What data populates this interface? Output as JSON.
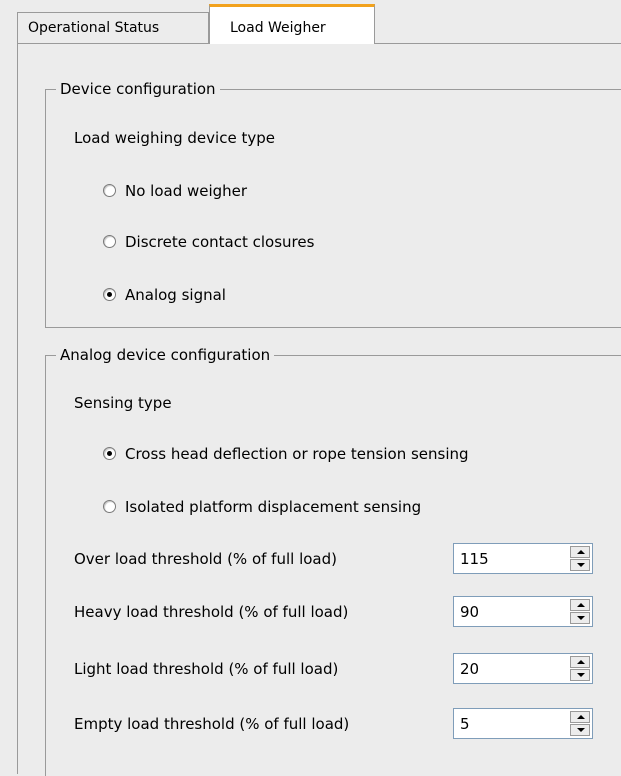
{
  "tabs": [
    {
      "label": "Operational Status",
      "active": false
    },
    {
      "label": "Load Weigher",
      "active": true
    }
  ],
  "colors": {
    "active_tab_accent": "#f2a21d",
    "background": "#ececec",
    "border": "#9a9a9a"
  },
  "device_configuration": {
    "legend": "Device configuration",
    "subheading": "Load weighing device type",
    "options": [
      {
        "label": "No load weigher",
        "selected": false
      },
      {
        "label": "Discrete contact closures",
        "selected": false
      },
      {
        "label": "Analog signal",
        "selected": true
      }
    ]
  },
  "analog_configuration": {
    "legend": "Analog device configuration",
    "subheading": "Sensing type",
    "options": [
      {
        "label": "Cross head deflection or rope tension sensing",
        "selected": true
      },
      {
        "label": "Isolated platform displacement sensing",
        "selected": false
      }
    ],
    "thresholds": [
      {
        "label": "Over load threshold (% of full load)",
        "value": "115"
      },
      {
        "label": "Heavy load threshold (% of full load)",
        "value": "90"
      },
      {
        "label": "Light load threshold (% of full load)",
        "value": "20"
      },
      {
        "label": "Empty load threshold (% of full load)",
        "value": "5"
      }
    ]
  }
}
